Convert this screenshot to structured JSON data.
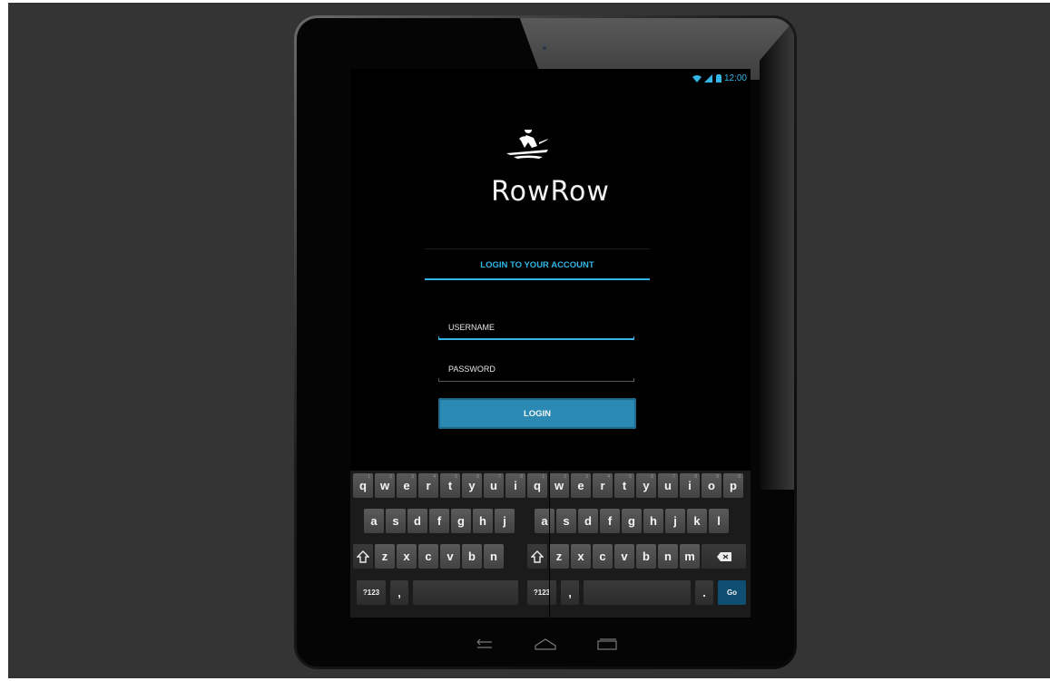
{
  "status_bar": {
    "time": "12:00",
    "icons": [
      "wifi-icon",
      "signal-icon",
      "battery-icon"
    ]
  },
  "app": {
    "name": "RowRow",
    "logo": "rower-icon"
  },
  "login_section": {
    "title": "LOGIN TO YOUR ACCOUNT"
  },
  "form": {
    "username": {
      "placeholder": "USERNAME",
      "value": ""
    },
    "password": {
      "placeholder": "PASSWORD",
      "value": ""
    },
    "login_label": "LOGIN"
  },
  "keyboard": {
    "row1": [
      "q",
      "w",
      "e",
      "r",
      "t",
      "y",
      "u",
      "i",
      "q",
      "w",
      "e",
      "r",
      "t",
      "y",
      "u",
      "i",
      "o",
      "p"
    ],
    "row1_hints": [
      "1",
      "2",
      "3",
      "4",
      "5",
      "6",
      "7",
      "8",
      "1",
      "2",
      "3",
      "4",
      "5",
      "6",
      "7",
      "8",
      "9",
      "0"
    ],
    "row2": [
      "a",
      "s",
      "d",
      "f",
      "g",
      "h",
      "j",
      "a",
      "s",
      "d",
      "f",
      "g",
      "h",
      "j",
      "k",
      "l"
    ],
    "row3": [
      "z",
      "x",
      "c",
      "v",
      "b",
      "n",
      "z",
      "x",
      "c",
      "v",
      "b",
      "n",
      "m"
    ],
    "symbols_label": "?123",
    "comma_label": ",",
    "period_label": ".",
    "go_label": "Go"
  },
  "colors": {
    "accent": "#33b5e5",
    "button": "#2a8ab4",
    "background": "#343434"
  }
}
